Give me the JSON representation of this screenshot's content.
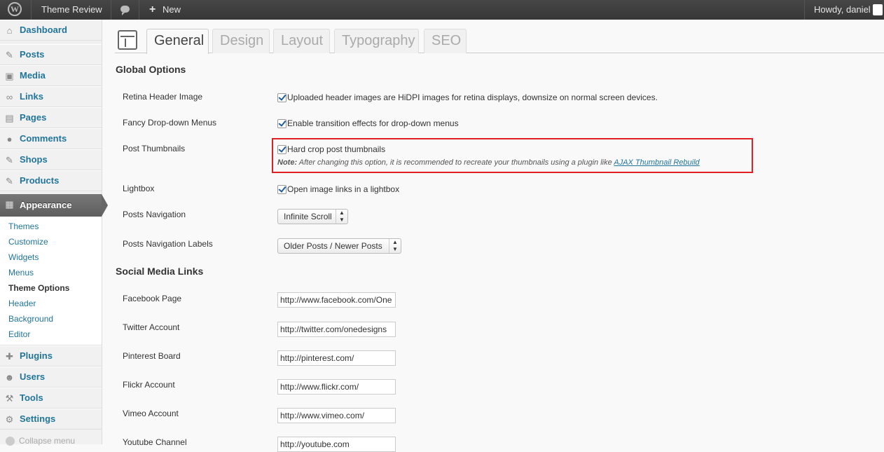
{
  "adminbar": {
    "site_name": "Theme Review",
    "new_label": "New",
    "greeting": "Howdy, daniel"
  },
  "sidemenu": {
    "items": [
      {
        "label": "Dashboard",
        "icon": "dashboard-icon"
      },
      {
        "label": "Posts",
        "icon": "pushpin-icon"
      },
      {
        "label": "Media",
        "icon": "media-icon"
      },
      {
        "label": "Links",
        "icon": "link-icon"
      },
      {
        "label": "Pages",
        "icon": "pages-icon"
      },
      {
        "label": "Comments",
        "icon": "comment-icon"
      },
      {
        "label": "Shops",
        "icon": "pushpin-icon"
      },
      {
        "label": "Products",
        "icon": "pushpin-icon"
      },
      {
        "label": "Appearance",
        "icon": "appearance-icon"
      }
    ],
    "submenu": [
      "Themes",
      "Customize",
      "Widgets",
      "Menus",
      "Theme Options",
      "Header",
      "Background",
      "Editor"
    ],
    "bottom_items": [
      {
        "label": "Plugins",
        "icon": "plugin-icon"
      },
      {
        "label": "Users",
        "icon": "users-icon"
      },
      {
        "label": "Tools",
        "icon": "tools-icon"
      },
      {
        "label": "Settings",
        "icon": "settings-icon"
      }
    ],
    "collapse_label": "Collapse menu"
  },
  "tabs": [
    "General",
    "Design",
    "Layout",
    "Typography",
    "SEO"
  ],
  "active_tab": "General",
  "global_options": {
    "title": "Global Options",
    "retina": {
      "label": "Retina Header Image",
      "checkbox": "Uploaded header images are HiDPI images for retina displays, downsize on normal screen devices.",
      "checked": true
    },
    "fancy": {
      "label": "Fancy Drop-down Menus",
      "checkbox": "Enable transition effects for drop-down menus",
      "checked": true
    },
    "thumbs": {
      "label": "Post Thumbnails",
      "checkbox": "Hard crop post thumbnails",
      "checked": true,
      "note_prefix": "Note:",
      "note_text": " After changing this option, it is recommended to recreate your thumbnails using a plugin like ",
      "note_link": "AJAX Thumbnail Rebuild"
    },
    "lightbox": {
      "label": "Lightbox",
      "checkbox": "Open image links in a lightbox",
      "checked": true
    },
    "posts_nav": {
      "label": "Posts Navigation",
      "value": "Infinite Scroll"
    },
    "posts_nav_labels": {
      "label": "Posts Navigation Labels",
      "value": "Older Posts / Newer Posts"
    }
  },
  "social": {
    "title": "Social Media Links",
    "fields": [
      {
        "label": "Facebook Page",
        "value": "http://www.facebook.com/One"
      },
      {
        "label": "Twitter Account",
        "value": "http://twitter.com/onedesigns"
      },
      {
        "label": "Pinterest Board",
        "value": "http://pinterest.com/"
      },
      {
        "label": "Flickr Account",
        "value": "http://www.flickr.com/"
      },
      {
        "label": "Vimeo Account",
        "value": "http://www.vimeo.com/"
      },
      {
        "label": "Youtube Channel",
        "value": "http://youtube.com"
      }
    ]
  },
  "colors": {
    "link": "#21759b",
    "highlight": "#e02020",
    "adminbar": "#464646"
  }
}
